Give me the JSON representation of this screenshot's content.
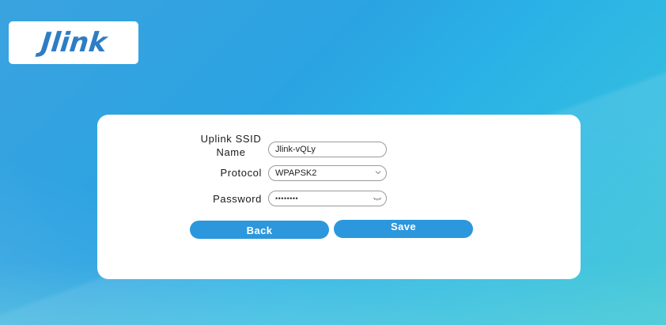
{
  "brand": {
    "logo_text": "Jlink"
  },
  "form": {
    "ssid_label": "Uplink SSID Name",
    "ssid_label_line1": "Uplink SSID",
    "ssid_label_line2": "Name",
    "ssid_value": "Jlink-vQLy",
    "protocol_label": "Protocol",
    "protocol_value": "WPAPSK2",
    "password_label": "Password",
    "password_value": "••••••••"
  },
  "buttons": {
    "back_label": "Back",
    "save_label": "Save"
  },
  "icons": {
    "protocol_dropdown": "chevron-down-icon",
    "password_toggle": "eye-closed-icon"
  },
  "colors": {
    "accent": "#2c97dc",
    "logo": "#2e7dc4",
    "background": "#2ba3e2"
  }
}
